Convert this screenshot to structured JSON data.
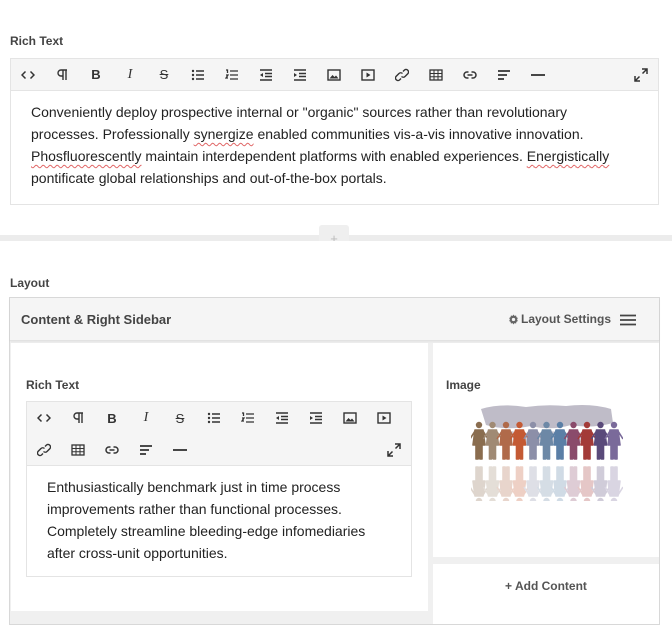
{
  "top_block": {
    "label": "Rich Text",
    "paragraph_parts": [
      "Conveniently deploy prospective internal or \"organic\" sources rather than revolutionary processes. Professionally ",
      "synergize",
      " enabled communities vis-a-vis innovative innovation. ",
      "Phosfluorescently",
      " maintain interdependent platforms with enabled experiences. ",
      "Energistically",
      " pontificate global relationships and out-of-the-box portals."
    ]
  },
  "add_button_label": "+",
  "layout_block": {
    "label": "Layout",
    "title": "Content & Right Sidebar",
    "settings_label": "Layout Settings",
    "left_column": {
      "label": "Rich Text",
      "paragraph": "Enthusiastically benchmark just in time process improvements rather than functional processes. Completely streamline bleeding-edge infomediaries after cross-unit opportunities."
    },
    "right_column": {
      "label": "Image",
      "add_content_label": "+ Add Content"
    }
  },
  "toolbar_icons": [
    "code-icon",
    "paragraph-icon",
    "bold-icon",
    "italic-icon",
    "strikethrough-icon",
    "bullet-list-icon",
    "numbered-list-icon",
    "outdent-icon",
    "indent-icon",
    "image-icon",
    "video-icon",
    "link-icon",
    "table-icon",
    "hyperlink-icon",
    "align-icon",
    "horizontal-rule-icon"
  ],
  "fullscreen_icon": "fullscreen-icon",
  "menu_icon": "hamburger-menu-icon",
  "gear_icon": "gear-icon",
  "people_colors": [
    "#8a6d4f",
    "#a08a74",
    "#b06a4a",
    "#c45a34",
    "#8c8fa8",
    "#6d88a6",
    "#5b7fa6",
    "#8a4b6b",
    "#a33a38",
    "#5a4a7a",
    "#7a6a9a"
  ]
}
